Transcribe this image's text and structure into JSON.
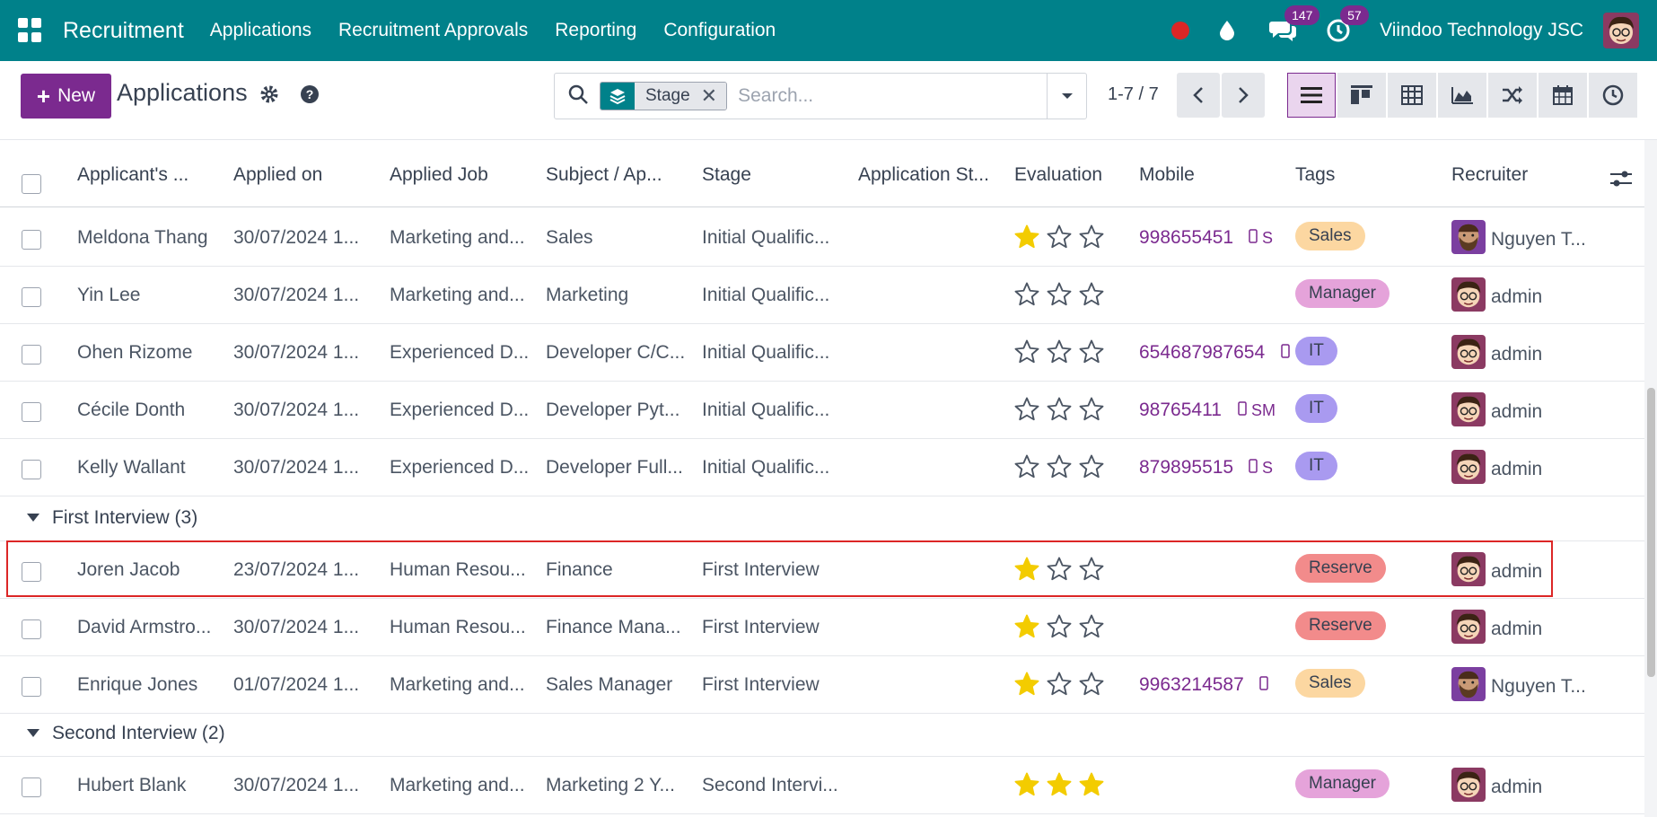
{
  "nav": {
    "app_title": "Recruitment",
    "menu": [
      "Applications",
      "Recruitment Approvals",
      "Reporting",
      "Configuration"
    ],
    "messages_badge": "147",
    "activities_badge": "57",
    "company": "Viindoo Technology JSC"
  },
  "control": {
    "new_label": "New",
    "page_title": "Applications",
    "facet_label": "Stage",
    "facet_remove": "✕",
    "search_placeholder": "Search...",
    "pager_text": "1-7 / 7"
  },
  "columns": [
    "Applicant's ...",
    "Applied on",
    "Applied Job",
    "Subject / Ap...",
    "Stage",
    "Application St...",
    "Evaluation",
    "Mobile",
    "Tags",
    "Recruiter"
  ],
  "colors": {
    "primary": "#7b2a8f",
    "navbar": "#00818a",
    "star": "#f3cc00",
    "highlight": "#dc2626"
  },
  "tags": {
    "Sales": "#fcd7a1",
    "Manager": "#e5a3da",
    "IT": "#a99af0",
    "Reserve": "#f28b8b"
  },
  "rows_top": [
    {
      "name": "Meldona Thang",
      "applied_on": "30/07/2024 1...",
      "job": "Marketing and...",
      "subject": "Sales",
      "stage": "Initial Qualific...",
      "stars": 1,
      "mobile": "998655451",
      "sms": "S",
      "tag": "Sales",
      "recruiter": "Nguyen T...",
      "avatar": "bearded"
    },
    {
      "name": "Yin Lee",
      "applied_on": "30/07/2024 1...",
      "job": "Marketing and...",
      "subject": "Marketing",
      "stage": "Initial Qualific...",
      "stars": 0,
      "mobile": "",
      "sms": "",
      "tag": "Manager",
      "recruiter": "admin",
      "avatar": "admin"
    },
    {
      "name": "Ohen Rizome",
      "applied_on": "30/07/2024 1...",
      "job": "Experienced D...",
      "subject": "Developer C/C...",
      "stage": "Initial Qualific...",
      "stars": 0,
      "mobile": "654687987654",
      "sms": "",
      "tag": "IT",
      "recruiter": "admin",
      "avatar": "admin"
    },
    {
      "name": "Cécile Donth",
      "applied_on": "30/07/2024 1...",
      "job": "Experienced D...",
      "subject": "Developer Pyt...",
      "stage": "Initial Qualific...",
      "stars": 0,
      "mobile": "98765411",
      "sms": "SM",
      "tag": "IT",
      "recruiter": "admin",
      "avatar": "admin"
    },
    {
      "name": "Kelly Wallant",
      "applied_on": "30/07/2024 1...",
      "job": "Experienced D...",
      "subject": "Developer Full...",
      "stage": "Initial Qualific...",
      "stars": 0,
      "mobile": "879895515",
      "sms": "S",
      "tag": "IT",
      "recruiter": "admin",
      "avatar": "admin"
    }
  ],
  "group_first": "First Interview (3)",
  "rows_first": [
    {
      "name": "Joren Jacob",
      "applied_on": "23/07/2024 1...",
      "job": "Human Resou...",
      "subject": "Finance",
      "stage": "First Interview",
      "stars": 1,
      "mobile": "",
      "sms": "",
      "tag": "Reserve",
      "recruiter": "admin",
      "avatar": "admin"
    },
    {
      "name": "David Armstro...",
      "applied_on": "30/07/2024 1...",
      "job": "Human Resou...",
      "subject": "Finance Mana...",
      "stage": "First Interview",
      "stars": 1,
      "mobile": "",
      "sms": "",
      "tag": "Reserve",
      "recruiter": "admin",
      "avatar": "admin"
    },
    {
      "name": "Enrique Jones",
      "applied_on": "01/07/2024 1...",
      "job": "Marketing and...",
      "subject": "Sales Manager",
      "stage": "First Interview",
      "stars": 1,
      "mobile": "9963214587",
      "sms": "",
      "tag": "Sales",
      "recruiter": "Nguyen T...",
      "avatar": "bearded"
    }
  ],
  "group_second": "Second Interview (2)",
  "rows_second": [
    {
      "name": "Hubert Blank",
      "applied_on": "30/07/2024 1...",
      "job": "Marketing and...",
      "subject": "Marketing 2 Y...",
      "stage": "Second Intervi...",
      "stars": 3,
      "mobile": "",
      "sms": "",
      "tag": "Manager",
      "recruiter": "admin",
      "avatar": "admin"
    }
  ]
}
